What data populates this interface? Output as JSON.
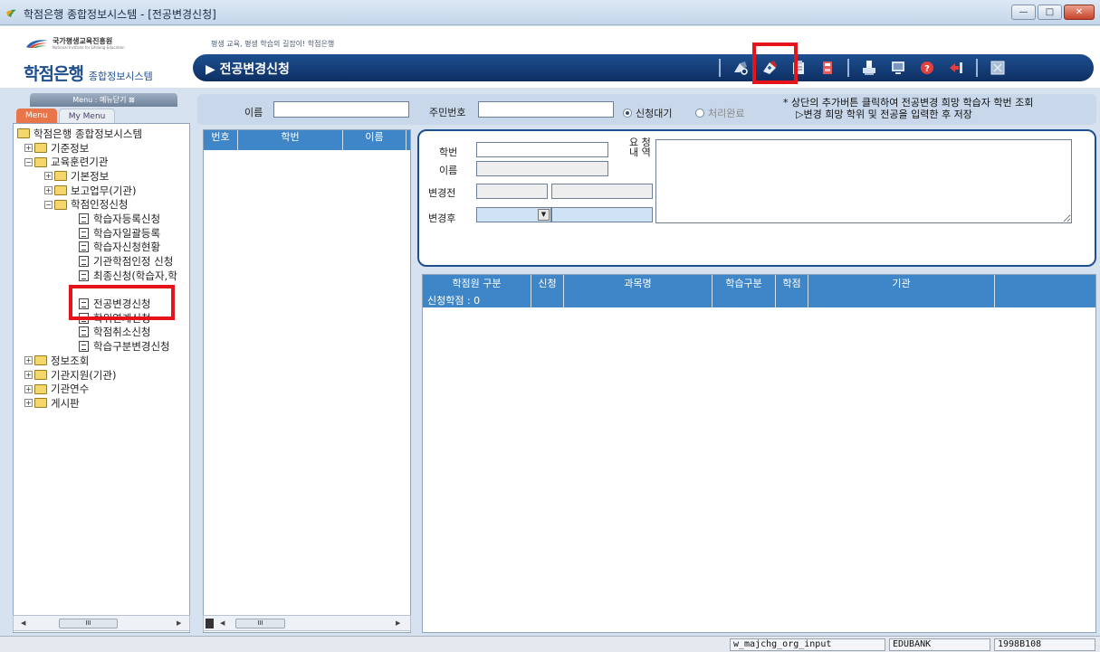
{
  "window": {
    "title": "학점은행 종합정보시스템 - [전공변경신청]",
    "buttons": {
      "minimize": "—",
      "maximize": "□",
      "close": "✕"
    }
  },
  "header": {
    "institute_name": "국가평생교육진흥원",
    "institute_sub": "National Institute for Lifelong Education",
    "slogan": "평생 교육, 평생 학습의 길잡이! 학점은행",
    "brand_main": "학점은행",
    "brand_sub": "종합정보시스템",
    "page_title": "▶ 전공변경신청",
    "accent_color": "#1d4f8f",
    "highlight_color": "#e5141a",
    "toolbar_icons": [
      "search-icon",
      "add-icon",
      "save-icon",
      "delete-icon",
      "print-icon",
      "preview-icon",
      "help-icon",
      "back-icon",
      "close-icon"
    ]
  },
  "menu": {
    "header_label": "Menu : 메뉴닫기 ⊠",
    "tabs": [
      "Menu",
      "My Menu"
    ],
    "tree": [
      {
        "label": "학점은행 종합정보시스템",
        "type": "folder",
        "level": 0,
        "expander": ""
      },
      {
        "label": "기준정보",
        "type": "folder",
        "level": 1,
        "expander": "+"
      },
      {
        "label": "교육훈련기관",
        "type": "folder",
        "level": 1,
        "expander": "−"
      },
      {
        "label": "기본정보",
        "type": "folder",
        "level": 2,
        "expander": "+"
      },
      {
        "label": "보고업무(기관)",
        "type": "folder",
        "level": 2,
        "expander": "+"
      },
      {
        "label": "학점인정신청",
        "type": "folder",
        "level": 2,
        "expander": "−"
      },
      {
        "label": "학습자등록신청",
        "type": "doc",
        "level": 3,
        "expander": ""
      },
      {
        "label": "학습자일괄등록",
        "type": "doc",
        "level": 3,
        "expander": ""
      },
      {
        "label": "학습자신청현황",
        "type": "doc",
        "level": 3,
        "expander": ""
      },
      {
        "label": "기관학점인정 신청",
        "type": "doc",
        "level": 3,
        "expander": ""
      },
      {
        "label": "최종신청(학습자,학",
        "type": "doc",
        "level": 3,
        "expander": ""
      },
      {
        "label": "",
        "type": "blank",
        "level": 3,
        "expander": ""
      },
      {
        "label": "전공변경신청",
        "type": "doc",
        "level": 3,
        "expander": ""
      },
      {
        "label": "학위연계신청",
        "type": "doc",
        "level": 3,
        "expander": ""
      },
      {
        "label": "학점취소신청",
        "type": "doc",
        "level": 3,
        "expander": ""
      },
      {
        "label": "학습구분변경신청",
        "type": "doc",
        "level": 3,
        "expander": ""
      },
      {
        "label": "정보조회",
        "type": "folder",
        "level": 1,
        "expander": "+"
      },
      {
        "label": "기관지원(기관)",
        "type": "folder",
        "level": 1,
        "expander": "+"
      },
      {
        "label": "기관연수",
        "type": "folder",
        "level": 1,
        "expander": "+"
      },
      {
        "label": "게시판",
        "type": "folder",
        "level": 1,
        "expander": "+"
      }
    ],
    "scroll_thumb": "III"
  },
  "search": {
    "name_label": "이름",
    "name_value": "",
    "rrn_label": "주민번호",
    "rrn_value": "",
    "radio_waiting": "신청대기",
    "radio_done": "처리완료",
    "hint_line1": "* 상단의 추가버튼 클릭하여 전공변경 희망 학습자 학번 조회",
    "hint_line2": "▷변경 희망 학위 및 전공을 입력한 후 저장"
  },
  "student_list": {
    "columns": [
      "번호",
      "학번",
      "이름"
    ],
    "scroll_thumb": "III"
  },
  "detail": {
    "student_id_label": "학번",
    "name_label": "이름",
    "before_label": "변경전",
    "after_label": "변경후",
    "request_label_1": "요 청",
    "request_label_2": "내 역",
    "student_id_value": "",
    "name_value": ""
  },
  "credit_grid": {
    "columns": [
      "학점원 구분",
      "신청",
      "과목명",
      "학습구분",
      "학점",
      "기관",
      ""
    ],
    "summary": "신청학점 : 0"
  },
  "status": {
    "object": "w_majchg_org_input",
    "user": "EDUBANK",
    "code": "1998B108"
  }
}
